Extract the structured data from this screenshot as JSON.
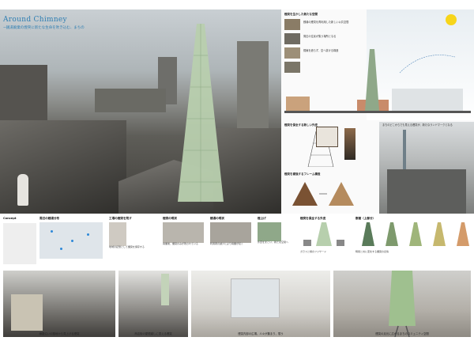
{
  "title": {
    "main": "Around Chimney",
    "sub": "~銭湯廃業の煙突に新たな生命を吹き込む、まちの"
  },
  "right_panel": {
    "header": "煙突を生かした新たな空間",
    "notes": [
      "銭湯の煙突を再利用した新しい公共空間",
      "周辺の住民が集う場所となる",
      "視線を遮らず、空へ抜ける構造"
    ],
    "section_a": "煙突を保全する新しい外皮",
    "section_b": "煙突を補強するフレーム構造",
    "city_caption": "まちのどこからでも見える煙突が、新たなランドマークとなる"
  },
  "mid": {
    "concept_label": "Concept",
    "cells": [
      {
        "title": "周辺の銭湯分布",
        "text": "かつてこの地域には多くの銭湯が点在していた"
      },
      {
        "title": "工場の煙突を残す",
        "text": "地域の記憶として煙突を保存する"
      },
      {
        "title": "煙突の現状",
        "text": "廃業後、煙突のみが残されている"
      },
      {
        "title": "銭湯の現状",
        "text": "利用者の減少により廃業が続く"
      },
      {
        "title": "煙上げ",
        "text": "外皮をまとい、新たな空間へ"
      },
      {
        "title": "煙突を保全する外皮",
        "text": "ガラスと緑のファサード"
      },
      {
        "title": "断面（上部分）",
        "text": "時間と共に変化する煙突の表情"
      }
    ]
  },
  "bottom": {
    "captions": [
      "線路沿いの路地から見上げる煙突",
      "商店街の屋根越しに見える煙突",
      "煙突内部の広場。人々が集まり、憩う",
      "煙突の足元に広がるまちのコミュニティ空間"
    ]
  },
  "colors": {
    "title": "#2f7fb3",
    "tower_glass": "#a9c4a0",
    "sun": "#f7d51a"
  }
}
